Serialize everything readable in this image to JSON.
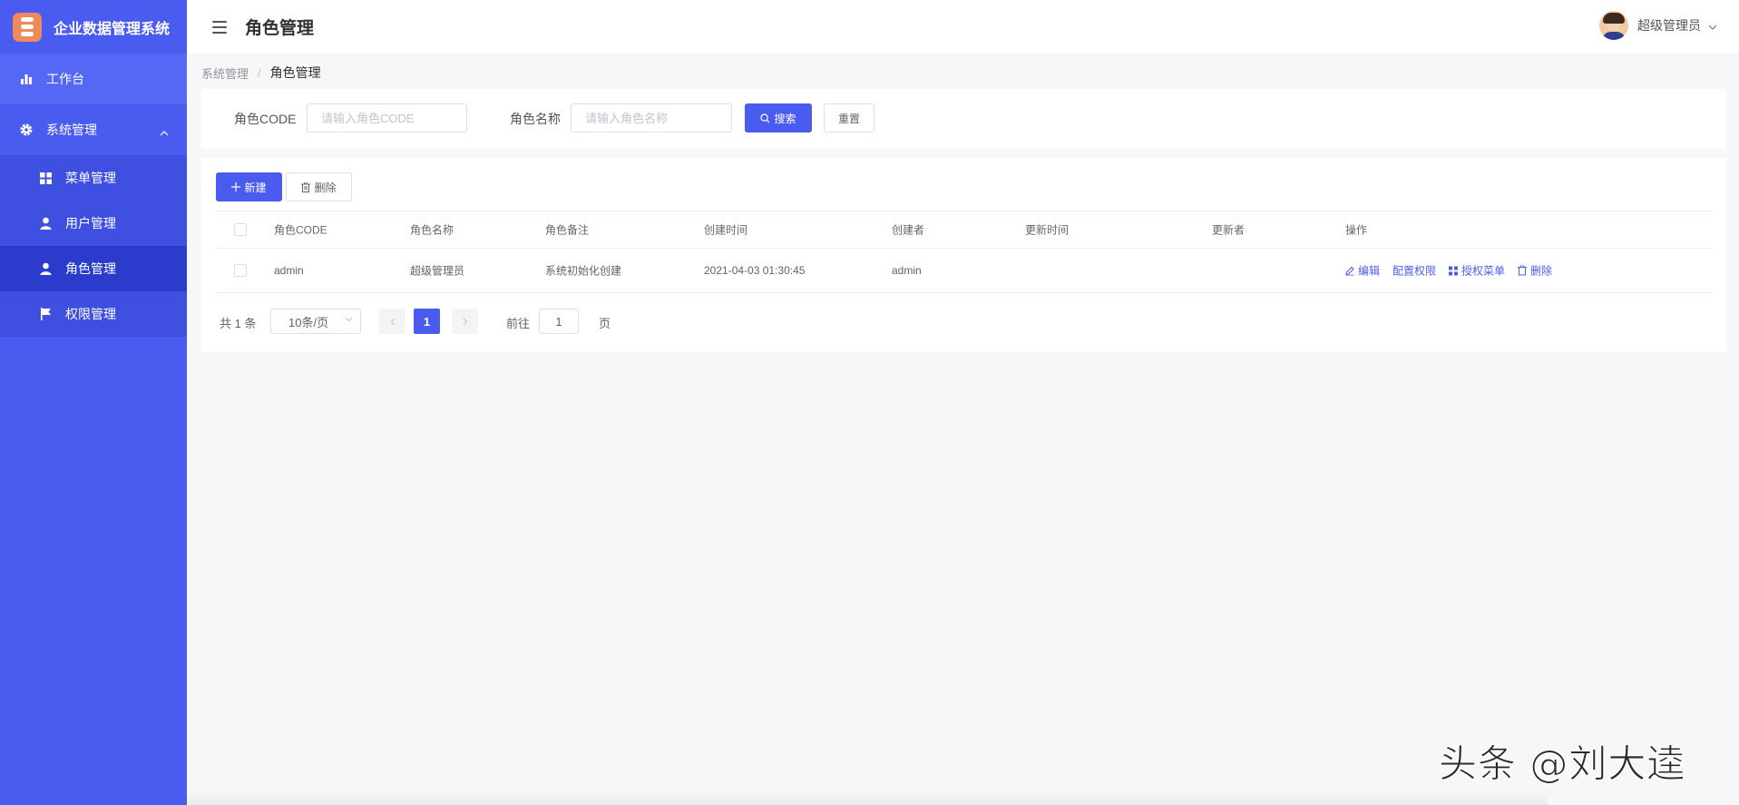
{
  "app": {
    "title": "企业数据管理系统"
  },
  "sidebar": {
    "items": [
      {
        "label": "工作台",
        "icon": "bar-chart-icon"
      },
      {
        "label": "系统管理",
        "icon": "gear-icon",
        "expanded": true,
        "children": [
          {
            "label": "菜单管理",
            "icon": "grid-icon"
          },
          {
            "label": "用户管理",
            "icon": "user-icon"
          },
          {
            "label": "角色管理",
            "icon": "user-icon",
            "active": true
          },
          {
            "label": "权限管理",
            "icon": "flag-icon"
          }
        ]
      }
    ]
  },
  "header": {
    "title": "角色管理",
    "user_name": "超级管理员"
  },
  "breadcrumb": {
    "parent": "系统管理",
    "separator": "/",
    "current": "角色管理"
  },
  "search": {
    "code_label": "角色CODE",
    "code_placeholder": "请输入角色CODE",
    "name_label": "角色名称",
    "name_placeholder": "请输入角色名称",
    "search_button": "搜索",
    "reset_button": "重置"
  },
  "toolbar": {
    "new_button": "新建",
    "delete_button": "删除"
  },
  "table": {
    "columns": [
      "角色CODE",
      "角色名称",
      "角色备注",
      "创建时间",
      "创建者",
      "更新时间",
      "更新者",
      "操作"
    ],
    "rows": [
      {
        "code": "admin",
        "name": "超级管理员",
        "remark": "系统初始化创建",
        "created_at": "2021-04-03 01:30:45",
        "creator": "admin",
        "updated_at": "",
        "updater": ""
      }
    ],
    "actions": [
      "编辑",
      "配置权限",
      "授权菜单",
      "删除"
    ]
  },
  "pagination": {
    "total_text": "共 1 条",
    "page_size": "10条/页",
    "current_page": "1",
    "goto_label": "前往",
    "goto_value": "1",
    "page_suffix": "页"
  },
  "watermark": "头条 @刘大逵",
  "colors": {
    "primary": "#4a5bef",
    "sidebar_active": "#2b3ccd",
    "logo": "#f08a5d"
  }
}
